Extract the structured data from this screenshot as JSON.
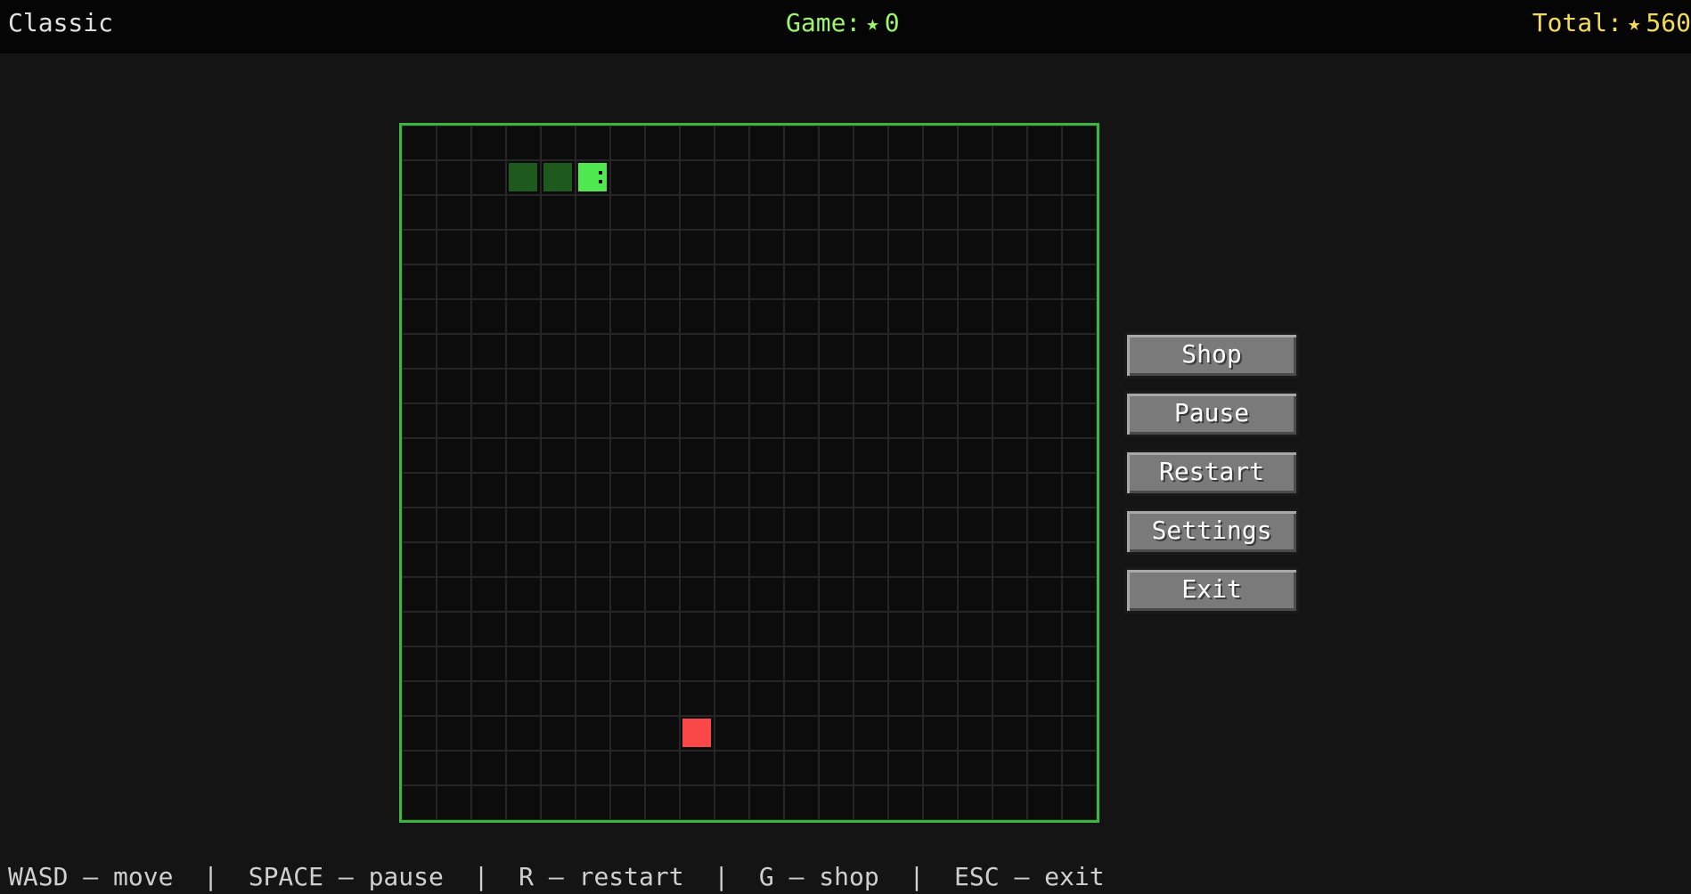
{
  "header": {
    "mode": "Classic",
    "game_label": "Game:",
    "game_score": "0",
    "total_label": "Total:",
    "total_coins": "560",
    "star_glyph": "★"
  },
  "board": {
    "cols": 20,
    "rows": 20,
    "snake": [
      {
        "col": 3,
        "row": 1
      },
      {
        "col": 4,
        "row": 1
      },
      {
        "col": 5,
        "row": 1
      }
    ],
    "direction": "right",
    "food": {
      "col": 8,
      "row": 17
    }
  },
  "menu": {
    "items": [
      {
        "label": "Shop"
      },
      {
        "label": "Pause"
      },
      {
        "label": "Restart"
      },
      {
        "label": "Settings"
      },
      {
        "label": "Exit"
      }
    ]
  },
  "footer": {
    "hint": "WASD — move  |  SPACE — pause  |  R — restart  |  G — shop  |  ESC — exit"
  },
  "colors": {
    "border": "#3db43d",
    "snake_head": "#4fe94f",
    "snake_body": "#1e5a1e",
    "food": "#fa4848",
    "game_score": "#9cf56a",
    "total_coins": "#f5dc55"
  }
}
